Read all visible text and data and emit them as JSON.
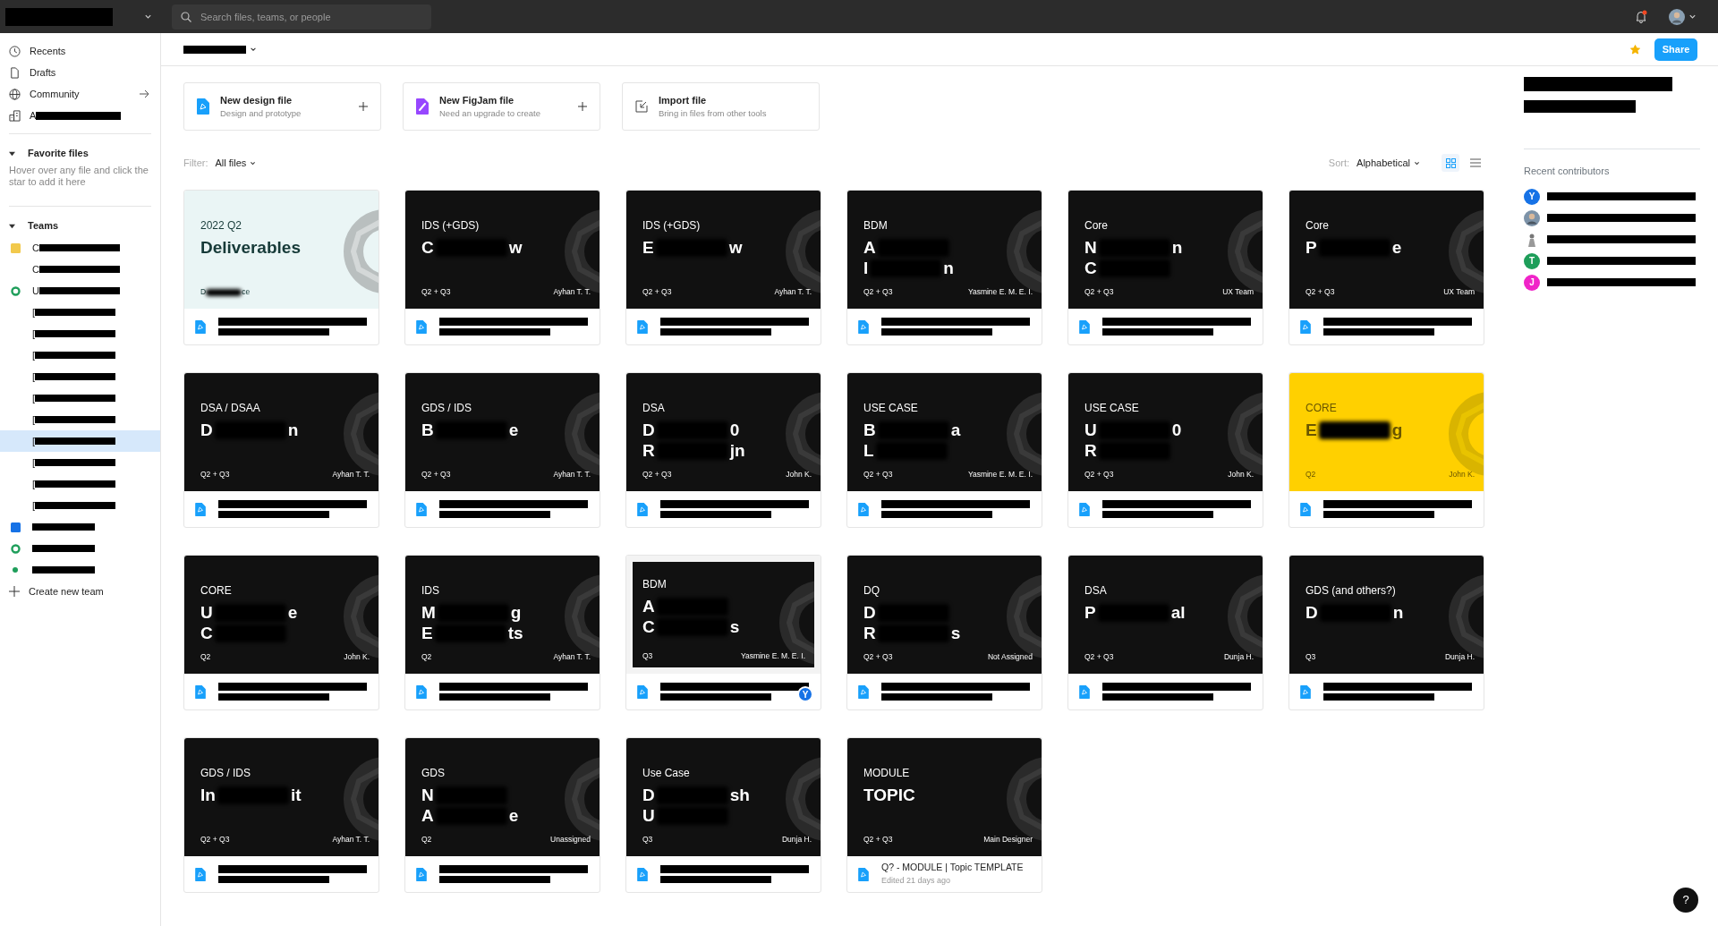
{
  "topbar": {
    "search": {
      "placeholder": "Search files, teams, or people"
    },
    "notification_unread": true
  },
  "sidebar": {
    "nav": [
      {
        "label": "Recents",
        "kind": "clock",
        "arrow": false
      },
      {
        "label": "Drafts",
        "kind": "file",
        "arrow": false
      },
      {
        "label": "Community",
        "kind": "globe",
        "arrow": true
      },
      {
        "label": "A",
        "kind": "building",
        "arrow": false
      }
    ],
    "favorites": {
      "title": "Favorite files",
      "expanded": true,
      "hint": "Hover over any file and click the star to add it here"
    },
    "teams": {
      "title": "Teams",
      "expanded": true,
      "items": [
        {
          "prefix": "C",
          "kind": "square",
          "color": "#f2c94c",
          "selected": false
        },
        {
          "prefix": "C",
          "selected": false
        },
        {
          "prefix": "U",
          "kind": "ring",
          "color": "#1e9e5a",
          "selected": false
        },
        {
          "prefix": "[",
          "selected": false
        },
        {
          "prefix": "[",
          "selected": false
        },
        {
          "prefix": "[",
          "selected": false
        },
        {
          "prefix": "[",
          "selected": false
        },
        {
          "prefix": "[",
          "selected": false
        },
        {
          "prefix": "[",
          "selected": false
        },
        {
          "prefix": "[",
          "selected": true
        },
        {
          "prefix": "[",
          "selected": false
        },
        {
          "prefix": "[",
          "selected": false
        },
        {
          "prefix": "[",
          "selected": false
        },
        {
          "kind": "square",
          "color": "#1672e6",
          "selected": false
        },
        {
          "kind": "ring",
          "color": "#1e9e5a",
          "selected": false
        },
        {
          "kind": "dot",
          "color": "#1e9e5a",
          "selected": false
        }
      ],
      "create": "Create new team"
    }
  },
  "header": {
    "favorite": true,
    "share": "Share"
  },
  "new_files": [
    {
      "kind": "design",
      "title": "New design file",
      "subtitle": "Design and prototype",
      "plus": true
    },
    {
      "kind": "figjam",
      "title": "New FigJam file",
      "subtitle": "Need an upgrade to create",
      "plus": true
    },
    {
      "kind": "import",
      "title": "Import file",
      "subtitle": "Bring in files from other tools",
      "plus": false
    }
  ],
  "filter": {
    "label": "Filter:",
    "value": "All files"
  },
  "sort": {
    "label": "Sort:",
    "value": "Alphabetical",
    "view_buttons": [
      {
        "kind": "grid",
        "selected": true
      },
      {
        "kind": "list",
        "selected": false
      }
    ]
  },
  "files": [
    {
      "kind": "light",
      "category": "2022 Q2",
      "title_lines": [
        [
          "Deliverables"
        ]
      ],
      "quarter": [
        "D",
        "ce"
      ]
    },
    {
      "kind": "dark",
      "category": "IDS (+GDS)",
      "title_lines": [
        [
          "C",
          "w"
        ]
      ],
      "quarter": [
        "Q2 + Q3"
      ],
      "owner": "Ayhan T. T."
    },
    {
      "kind": "dark",
      "category": "IDS (+GDS)",
      "title_lines": [
        [
          "E",
          "w"
        ]
      ],
      "quarter": [
        "Q2 + Q3"
      ],
      "owner": "Ayhan T. T."
    },
    {
      "kind": "dark",
      "category": "BDM",
      "title_lines": [
        [
          "A"
        ],
        [
          "I",
          "n"
        ]
      ],
      "quarter": [
        "Q2 + Q3"
      ],
      "owner": "Yasmine E. M. E. I."
    },
    {
      "kind": "dark",
      "category": "Core",
      "title_lines": [
        [
          "N",
          "n"
        ],
        [
          "C"
        ]
      ],
      "quarter": [
        "Q2 + Q3"
      ],
      "owner": "UX Team"
    },
    {
      "kind": "dark",
      "category": "Core",
      "title_lines": [
        [
          "P",
          "e"
        ]
      ],
      "quarter": [
        "Q2 + Q3"
      ],
      "owner": "UX Team"
    },
    {
      "kind": "dark",
      "category": "DSA / DSAA",
      "title_lines": [
        [
          "D",
          "n"
        ]
      ],
      "quarter": [
        "Q2 + Q3"
      ],
      "owner": "Ayhan T. T."
    },
    {
      "kind": "dark",
      "category": "GDS / IDS",
      "title_lines": [
        [
          "B",
          "e"
        ]
      ],
      "quarter": [
        "Q2 + Q3"
      ],
      "owner": "Ayhan T. T."
    },
    {
      "kind": "dark",
      "category": "DSA",
      "title_lines": [
        [
          "D",
          "0"
        ],
        [
          "R",
          "jn"
        ]
      ],
      "quarter": [
        "Q2 + Q3"
      ],
      "owner": "John K."
    },
    {
      "kind": "dark",
      "category": "USE CASE",
      "title_lines": [
        [
          "B",
          "a"
        ],
        [
          "L"
        ]
      ],
      "quarter": [
        "Q2 + Q3"
      ],
      "owner": "Yasmine E. M. E. I."
    },
    {
      "kind": "dark",
      "category": "USE CASE",
      "title_lines": [
        [
          "U",
          "0"
        ],
        [
          "R"
        ]
      ],
      "quarter": [
        "Q2 + Q3"
      ],
      "owner": "John K."
    },
    {
      "kind": "yellow",
      "category": "CORE",
      "title_lines": [
        [
          "E",
          "g"
        ]
      ],
      "quarter": [
        "Q2"
      ],
      "owner": "John K."
    },
    {
      "kind": "dark",
      "category": "CORE",
      "title_lines": [
        [
          "U",
          "e"
        ],
        [
          "C"
        ]
      ],
      "quarter": [
        "Q2"
      ],
      "owner": "John K."
    },
    {
      "kind": "dark",
      "category": "IDS",
      "title_lines": [
        [
          "M",
          "g"
        ],
        [
          "E",
          "ts"
        ]
      ],
      "quarter": [
        "Q2"
      ],
      "owner": "Ayhan T. T."
    },
    {
      "kind": "framed",
      "category": "BDM",
      "title_lines": [
        [
          "A"
        ],
        [
          "C",
          "s"
        ]
      ],
      "quarter": [
        "Q3"
      ],
      "owner": "Yasmine E. M. E. I.",
      "badge": "Y"
    },
    {
      "kind": "dark",
      "category": "DQ",
      "title_lines": [
        [
          "D"
        ],
        [
          "R",
          "s"
        ]
      ],
      "quarter": [
        "Q2 + Q3"
      ],
      "owner": "Not Assigned"
    },
    {
      "kind": "dark",
      "category": "DSA",
      "title_lines": [
        [
          "P",
          "al"
        ]
      ],
      "quarter": [
        "Q2 + Q3"
      ],
      "owner": "Dunja H."
    },
    {
      "kind": "dark",
      "category": "GDS (and others?)",
      "title_lines": [
        [
          "D",
          "n"
        ]
      ],
      "quarter": [
        "Q3"
      ],
      "owner": "Dunja H."
    },
    {
      "kind": "dark",
      "category": "GDS / IDS",
      "title_lines": [
        [
          "In",
          "it"
        ]
      ],
      "quarter": [
        "Q2 + Q3"
      ],
      "owner": "Ayhan T. T."
    },
    {
      "kind": "dark",
      "category": "GDS",
      "title_lines": [
        [
          "N"
        ],
        [
          "A",
          "e"
        ]
      ],
      "quarter": [
        "Q2"
      ],
      "owner": "Unassigned"
    },
    {
      "kind": "dark",
      "category": "Use Case",
      "title_lines": [
        [
          "D",
          "sh"
        ],
        [
          "U"
        ]
      ],
      "quarter": [
        "Q3"
      ],
      "owner": "Dunja H."
    },
    {
      "kind": "dark",
      "category": "MODULE",
      "title_lines": [
        [
          "TOPIC"
        ]
      ],
      "quarter": [
        "Q2 + Q3"
      ],
      "owner": "Main Designer",
      "name": "Q? - MODULE | Topic TEMPLATE",
      "edited": "Edited 21 days ago"
    }
  ],
  "right": {
    "contributors_title": "Recent contributors",
    "contributors": [
      {
        "kind": "letter",
        "initial": "Y",
        "color": "#1672e6"
      },
      {
        "kind": "photo"
      },
      {
        "kind": "figure"
      },
      {
        "kind": "letter",
        "initial": "T",
        "color": "#1e9e5a"
      },
      {
        "kind": "letter",
        "initial": "J",
        "color": "#f024c8"
      }
    ]
  },
  "help": "?"
}
